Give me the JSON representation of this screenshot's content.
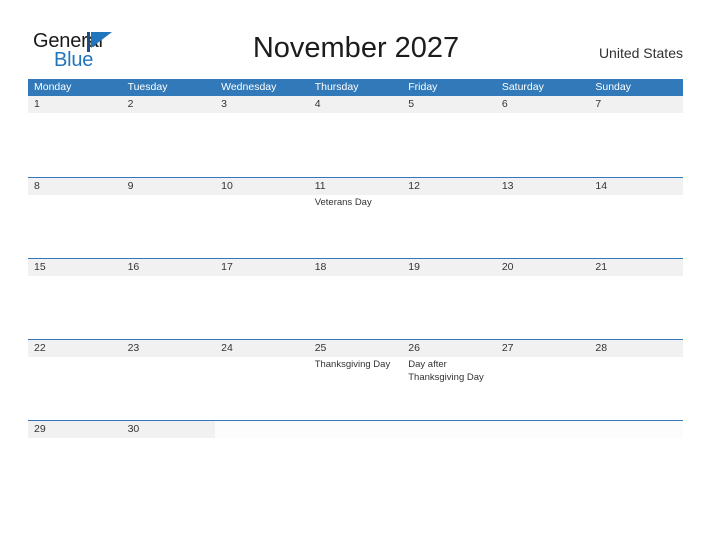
{
  "header": {
    "logo": {
      "text_top": "General",
      "text_bottom": "Blue",
      "flag_icon": "blue-triangle-flag-icon",
      "color_top": "#1a1a1a",
      "color_bottom": "#2175bd"
    },
    "title": "November 2027",
    "country": "United States"
  },
  "theme": {
    "header_blue": "#3179b9",
    "stripe_gray": "#f1f1f1",
    "empty_stripe": "#fcfcfc",
    "text_dark": "#333333",
    "logo_blue": "#2175bd"
  },
  "calendar": {
    "weekdays": [
      "Monday",
      "Tuesday",
      "Wednesday",
      "Thursday",
      "Friday",
      "Saturday",
      "Sunday"
    ],
    "weeks": [
      [
        {
          "day": "1",
          "events": []
        },
        {
          "day": "2",
          "events": []
        },
        {
          "day": "3",
          "events": []
        },
        {
          "day": "4",
          "events": []
        },
        {
          "day": "5",
          "events": []
        },
        {
          "day": "6",
          "events": []
        },
        {
          "day": "7",
          "events": []
        }
      ],
      [
        {
          "day": "8",
          "events": []
        },
        {
          "day": "9",
          "events": []
        },
        {
          "day": "10",
          "events": []
        },
        {
          "day": "11",
          "events": [
            "Veterans Day"
          ]
        },
        {
          "day": "12",
          "events": []
        },
        {
          "day": "13",
          "events": []
        },
        {
          "day": "14",
          "events": []
        }
      ],
      [
        {
          "day": "15",
          "events": []
        },
        {
          "day": "16",
          "events": []
        },
        {
          "day": "17",
          "events": []
        },
        {
          "day": "18",
          "events": []
        },
        {
          "day": "19",
          "events": []
        },
        {
          "day": "20",
          "events": []
        },
        {
          "day": "21",
          "events": []
        }
      ],
      [
        {
          "day": "22",
          "events": []
        },
        {
          "day": "23",
          "events": []
        },
        {
          "day": "24",
          "events": []
        },
        {
          "day": "25",
          "events": [
            "Thanksgiving Day"
          ]
        },
        {
          "day": "26",
          "events": [
            "Day after",
            "Thanksgiving Day"
          ]
        },
        {
          "day": "27",
          "events": []
        },
        {
          "day": "28",
          "events": []
        }
      ],
      [
        {
          "day": "29",
          "events": []
        },
        {
          "day": "30",
          "events": []
        },
        {
          "day": "",
          "events": []
        },
        {
          "day": "",
          "events": []
        },
        {
          "day": "",
          "events": []
        },
        {
          "day": "",
          "events": []
        },
        {
          "day": "",
          "events": []
        }
      ]
    ]
  }
}
